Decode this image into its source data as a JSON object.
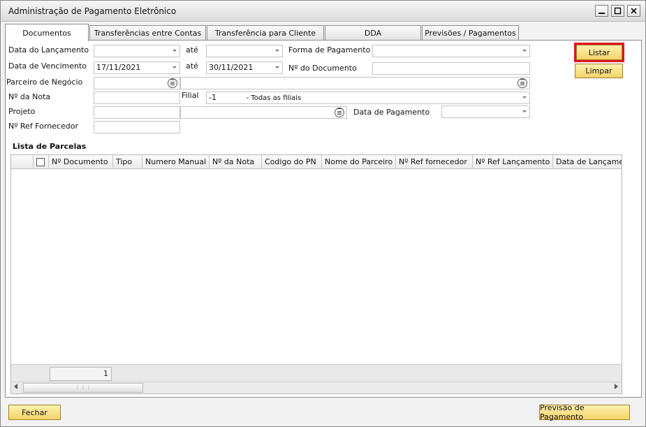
{
  "window": {
    "title": "Administração de Pagamento Eletrônico"
  },
  "tabs": [
    {
      "label": "Documentos",
      "active": true
    },
    {
      "label": "Transferências entre Contas",
      "active": false
    },
    {
      "label": "Transferência para Cliente",
      "active": false
    },
    {
      "label": "DDA",
      "active": false
    },
    {
      "label": "Previsões / Pagamentos",
      "active": false
    }
  ],
  "form": {
    "data_lancamento_label": "Data do Lançamento",
    "data_lancamento_de": "",
    "ate_label_1": "até",
    "data_lancamento_ate": "",
    "forma_pagamento_label": "Forma de Pagamento",
    "forma_pagamento_value": "",
    "data_vencimento_label": "Data de Vencimento",
    "data_vencimento_de": "17/11/2021",
    "ate_label_2": "até",
    "data_vencimento_ate": "30/11/2021",
    "numero_documento_label": "Nº do Documento",
    "numero_documento_value": "",
    "parceiro_label": "Parceiro de Negócio",
    "parceiro_code": "",
    "parceiro_name": "",
    "numero_nota_label": "Nº da Nota",
    "numero_nota_value": "",
    "filial_label": "Filial",
    "filial_code": "-1",
    "filial_name": "- Todas as filiais",
    "projeto_label": "Projeto",
    "projeto_code": "",
    "projeto_name": "",
    "data_pagamento_label": "Data de Pagamento",
    "data_pagamento_value": "",
    "ref_fornecedor_label": "Nº Ref Fornecedor",
    "ref_fornecedor_value": ""
  },
  "buttons": {
    "listar": "Listar",
    "limpar": "Limpar",
    "fechar": "Fechar",
    "previsao": "Previsão de Pagamento"
  },
  "grid": {
    "title": "Lista de Parcelas",
    "columns": [
      "Nº Documento",
      "Tipo",
      "Numero Manual",
      "Nº da Nota",
      "Codigo do PN",
      "Nome do Parceiro",
      "Nº Ref fornecedor",
      "Nº Ref Lançamento",
      "Data de Lançamento"
    ],
    "row_count": "1"
  },
  "colors": {
    "highlight": "#e0161a",
    "button_fill": "#f5d36a"
  }
}
